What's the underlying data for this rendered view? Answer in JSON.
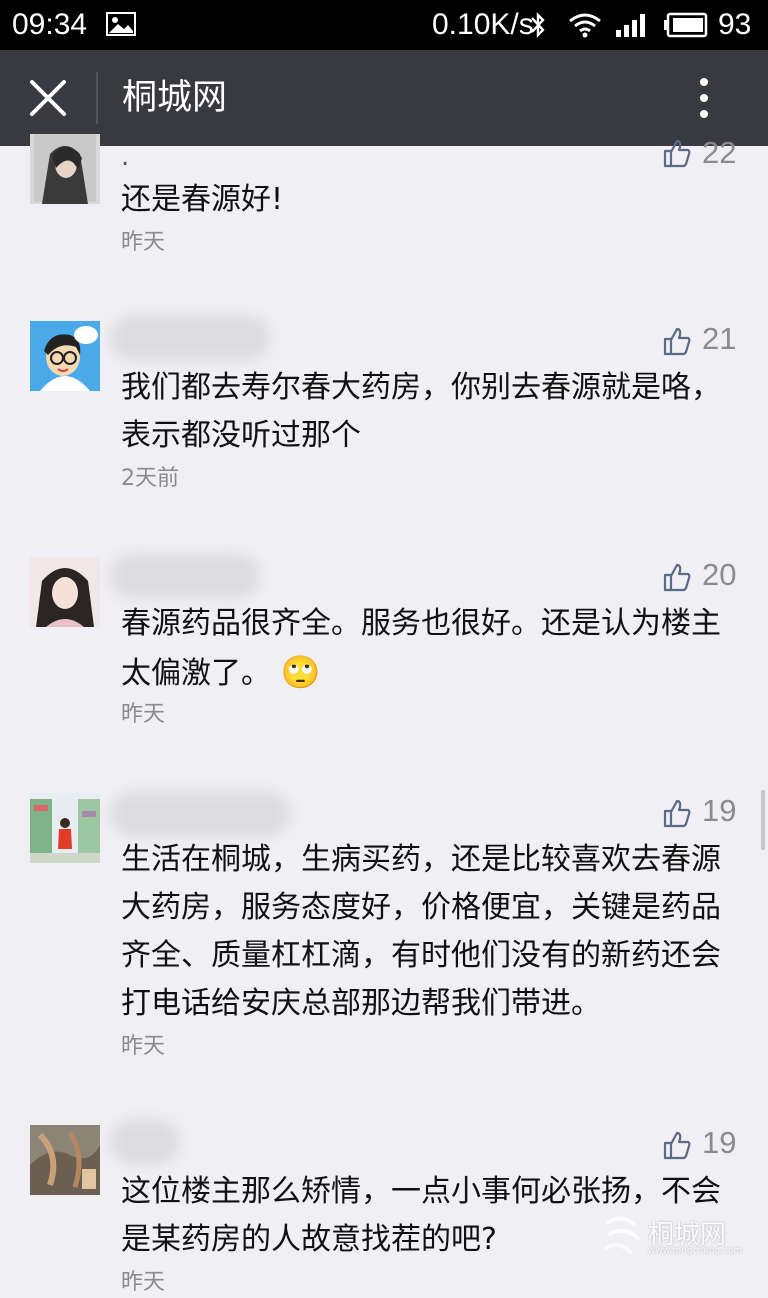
{
  "status_bar": {
    "time": "09:34",
    "network_speed": "0.10K/s",
    "battery": "93"
  },
  "header": {
    "title": "桐城网"
  },
  "comments": [
    {
      "name_visible": ".",
      "likes": "22",
      "text": "还是春源好!",
      "date": "昨天"
    },
    {
      "name_visible": "",
      "likes": "21",
      "text": "我们都去寿尔春大药房，你别去春源就是咯，表示都没听过那个",
      "date": "2天前"
    },
    {
      "name_visible": "",
      "likes": "20",
      "text": "春源药品很齐全。服务也很好。还是认为楼主太偏激了。",
      "date": "昨天",
      "emoji": "🙄"
    },
    {
      "name_visible": "",
      "likes": "19",
      "text": "生活在桐城，生病买药，还是比较喜欢去春源大药房，服务态度好，价格便宜，关键是药品齐全、质量杠杠滴，有时他们没有的新药还会打电话给安庆总部那边帮我们带进。",
      "date": "昨天"
    },
    {
      "name_visible": "",
      "likes": "19",
      "text": "这位楼主那么矫情，一点小事何必张扬，不会是某药房的人故意找茬的吧?",
      "date": "昨天"
    }
  ],
  "watermark": {
    "text": "桐城网",
    "url": "www.tongcheng.com"
  },
  "icons": {
    "close": "close-icon",
    "more": "more-vertical-icon",
    "like": "thumbs-up-icon"
  },
  "colors": {
    "header_bg": "#393a3f",
    "page_bg": "#efeff4",
    "meta_text": "#8a8a8f"
  }
}
